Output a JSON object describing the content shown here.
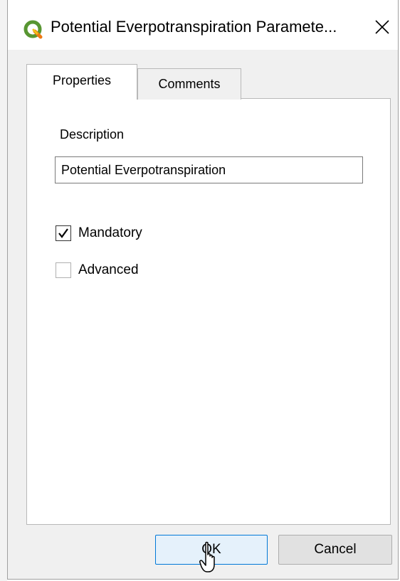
{
  "window": {
    "title": "Potential Everpotranspiration Paramete...",
    "app_icon": "qgis-icon",
    "close_icon": "close-icon"
  },
  "tabs": [
    {
      "label": "Properties",
      "active": true
    },
    {
      "label": "Comments",
      "active": false
    }
  ],
  "properties": {
    "description_label": "Description",
    "description_value": "Potential Everpotranspiration",
    "checkboxes": [
      {
        "label": "Mandatory",
        "checked": true
      },
      {
        "label": "Advanced",
        "checked": false
      }
    ]
  },
  "buttons": {
    "ok_label": "OK",
    "cancel_label": "Cancel"
  },
  "colors": {
    "accent": "#0078d7",
    "qgis_green": "#589632",
    "qgis_yellow": "#ee7913"
  }
}
